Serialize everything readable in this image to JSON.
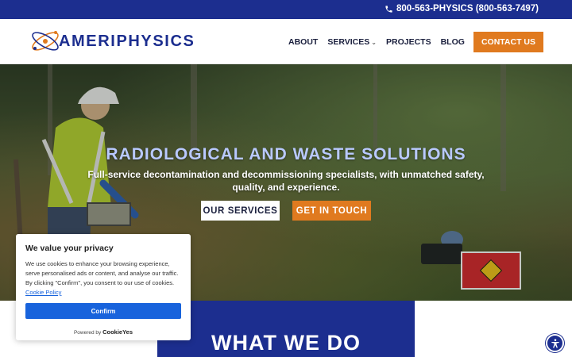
{
  "topbar": {
    "phone": "800-563-PHYSICS (800-563-7497)",
    "phone_icon": "phone-icon"
  },
  "header": {
    "brand": "AMERIPHYSICS",
    "logo_icon": "atom-logo-icon",
    "nav": {
      "about": "ABOUT",
      "services": "SERVICES",
      "projects": "PROJECTS",
      "blog": "BLOG",
      "contact": "CONTACT US"
    }
  },
  "hero": {
    "title": "RADIOLOGICAL AND WASTE SOLUTIONS",
    "subtitle": "Full-service decontamination and decommissioning specialists, with unmatched safety, quality, and experience.",
    "btn_services": "OUR SERVICES",
    "btn_touch": "GET IN TOUCH"
  },
  "section": {
    "heading": "WHAT WE DO"
  },
  "cookie": {
    "title": "We value your privacy",
    "text": "We use cookies to enhance your browsing experience, serve personalised ads or content, and analyse our traffic. By clicking \"Confirm\", you consent to our use of cookies.",
    "policy_link": "Cookie Policy",
    "confirm": "Confirm",
    "powered_by": "Powered by",
    "powered_brand": "CookieYes"
  },
  "accessibility": {
    "icon": "accessibility-icon"
  },
  "colors": {
    "brand_blue": "#1c2e8f",
    "accent_orange": "#e07a1f",
    "cookie_blue": "#1863dc",
    "hero_title": "#b9c9ff"
  }
}
